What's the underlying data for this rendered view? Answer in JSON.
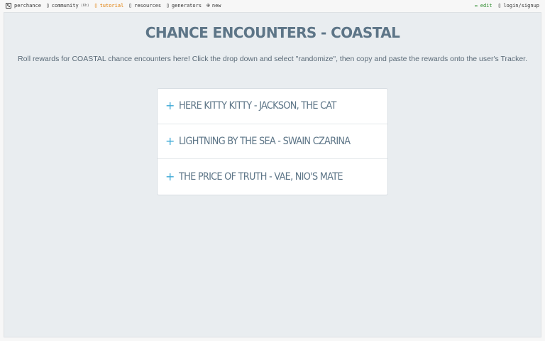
{
  "nav": {
    "left": [
      {
        "label": "perchance",
        "icon": "dice-icon"
      },
      {
        "label": "community",
        "badge": "(6h)",
        "icon": "chat-icon",
        "icon_glyph": "▯"
      },
      {
        "label": "tutorial",
        "icon": "book-icon",
        "icon_glyph": "▯"
      },
      {
        "label": "resources",
        "icon": "book-icon",
        "icon_glyph": "▯"
      },
      {
        "label": "generators",
        "icon": "list-icon",
        "icon_glyph": "▯"
      },
      {
        "label": "new",
        "icon": "plus-circle-icon",
        "icon_glyph": "⊕"
      }
    ],
    "right": [
      {
        "label": "edit",
        "icon": "pencil-icon",
        "icon_glyph": "✏"
      },
      {
        "label": "login/signup",
        "icon": "user-icon",
        "icon_glyph": "▯"
      }
    ]
  },
  "page": {
    "title": "CHANCE ENCOUNTERS - COASTAL",
    "intro": "Roll rewards for COASTAL chance encounters here! Click the drop down and select \"randomize\", then copy and paste the rewards onto the user's Tracker."
  },
  "accordion": {
    "expand_glyph": "+",
    "items": [
      {
        "label": "HERE KITTY KITTY - JACKSON, THE CAT"
      },
      {
        "label": "LIGHTNING BY THE SEA - SWAIN CZARINA"
      },
      {
        "label": "THE PRICE OF TRUTH - VAE, NIO'S MATE"
      }
    ]
  },
  "colors": {
    "title": "#5d7587",
    "accent_plus": "#3da9d6",
    "tutorial": "#e07b00",
    "edit": "#2a8a2a",
    "panel_bg": "#e9edf0"
  }
}
